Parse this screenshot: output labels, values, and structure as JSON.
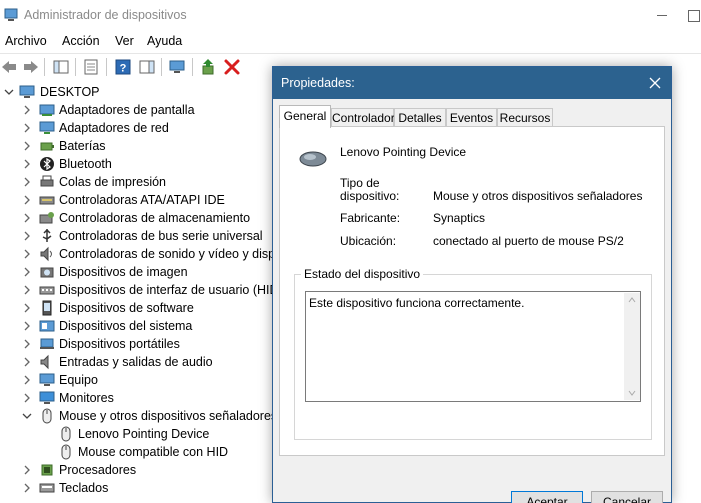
{
  "window": {
    "title": "Administrador de dispositivos"
  },
  "menu": [
    "Archivo",
    "Acción",
    "Ver",
    "Ayuda"
  ],
  "tree": {
    "root": "DESKTOP",
    "items": [
      {
        "label": "Adaptadores de pantalla",
        "icon": "display-adapter-icon"
      },
      {
        "label": "Adaptadores de red",
        "icon": "network-adapter-icon"
      },
      {
        "label": "Baterías",
        "icon": "battery-icon"
      },
      {
        "label": "Bluetooth",
        "icon": "bluetooth-icon"
      },
      {
        "label": "Colas de impresión",
        "icon": "printer-icon"
      },
      {
        "label": "Controladoras ATA/ATAPI IDE",
        "icon": "ide-controller-icon"
      },
      {
        "label": "Controladoras de almacenamiento",
        "icon": "storage-controller-icon"
      },
      {
        "label": "Controladoras de bus serie universal",
        "icon": "usb-icon"
      },
      {
        "label": "Controladoras de sonido y vídeo y dispositivos de juego",
        "icon": "sound-icon"
      },
      {
        "label": "Dispositivos de imagen",
        "icon": "camera-icon"
      },
      {
        "label": "Dispositivos de interfaz de usuario (HID)",
        "icon": "hid-icon"
      },
      {
        "label": "Dispositivos de software",
        "icon": "software-device-icon"
      },
      {
        "label": "Dispositivos del sistema",
        "icon": "system-device-icon"
      },
      {
        "label": "Dispositivos portátiles",
        "icon": "portable-device-icon"
      },
      {
        "label": "Entradas y salidas de audio",
        "icon": "speaker-icon"
      },
      {
        "label": "Equipo",
        "icon": "computer-icon"
      },
      {
        "label": "Monitores",
        "icon": "monitor-icon"
      },
      {
        "label": "Mouse y otros dispositivos señaladores",
        "icon": "mouse-icon",
        "expanded": true
      },
      {
        "label": "Lenovo Pointing Device",
        "icon": "mouse-icon",
        "child": true
      },
      {
        "label": "Mouse compatible con HID",
        "icon": "mouse-icon",
        "child": true
      },
      {
        "label": "Procesadores",
        "icon": "processor-icon"
      },
      {
        "label": "Teclados",
        "icon": "keyboard-icon"
      }
    ]
  },
  "dialog": {
    "title": "Propiedades:",
    "tabs": [
      "General",
      "Controlador",
      "Detalles",
      "Eventos",
      "Recursos"
    ],
    "device_name": "Lenovo Pointing Device",
    "type_label_1": "Tipo de",
    "type_label_2": "dispositivo:",
    "type_value": "Mouse y otros dispositivos señaladores",
    "manufacturer_label": "Fabricante:",
    "manufacturer_value": "Synaptics",
    "location_label": "Ubicación:",
    "location_value": "conectado al puerto de mouse PS/2",
    "status_legend": "Estado del dispositivo",
    "status_text": "Este dispositivo funciona correctamente.",
    "ok_label": "Aceptar",
    "cancel_label": "Cancelar"
  },
  "colors": {
    "dialog_title_bar": "#2c628f",
    "delete_red": "#d81e1e"
  }
}
